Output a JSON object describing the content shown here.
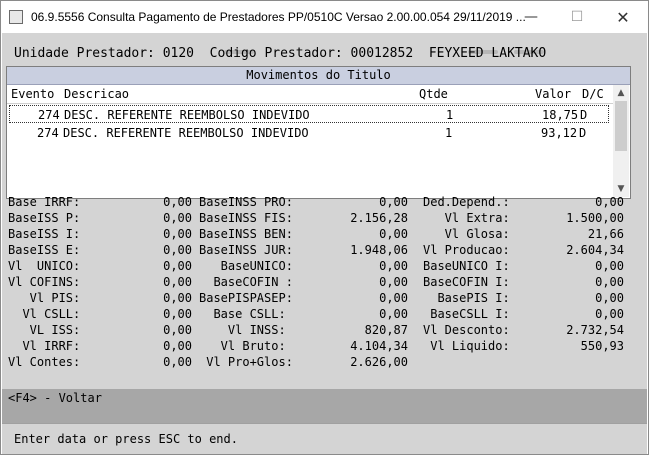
{
  "window": {
    "title": "06.9.5556   Consulta  Pagamento de Prestadores PP/0510C Versao 2.00.00.054 29/11/2019 ...",
    "min_icon": "minimize-icon",
    "max_icon": "maximize-icon",
    "close_icon": "close-icon"
  },
  "info": {
    "text": "Unidade Prestador: 0120  Codigo Prestador: 00012852  FEYXEED LAKTAKO"
  },
  "movimentos": {
    "title": "Movimentos do Titulo",
    "headers": {
      "evento": "Evento",
      "descricao": "Descricao",
      "qtde": "Qtde",
      "valor": "Valor",
      "dc": "D/C"
    },
    "rows": [
      {
        "evento": "274",
        "descricao": "DESC. REFERENTE REEMBOLSO INDEVIDO",
        "qtde": "1",
        "valor": "18,75",
        "dc": "D"
      },
      {
        "evento": "274",
        "descricao": "DESC. REFERENTE REEMBOLSO INDEVIDO",
        "qtde": "1",
        "valor": "93,12",
        "dc": "D"
      }
    ]
  },
  "totals": {
    "col1": [
      {
        "label": "Base IRRF:",
        "value": "0,00"
      },
      {
        "label": "BaseISS P:",
        "value": "0,00"
      },
      {
        "label": "BaseISS I:",
        "value": "0,00"
      },
      {
        "label": "BaseISS E:",
        "value": "0,00"
      },
      {
        "label": "Vl  UNICO:",
        "value": "0,00"
      },
      {
        "label": "Vl COFINS:",
        "value": "0,00"
      },
      {
        "label": "   Vl PIS:",
        "value": "0,00"
      },
      {
        "label": "  Vl CSLL:",
        "value": "0,00"
      },
      {
        "label": "   VL ISS:",
        "value": "0,00"
      },
      {
        "label": "  Vl IRRF:",
        "value": "0,00"
      },
      {
        "label": "Vl Contes:",
        "value": "0,00"
      }
    ],
    "col2": [
      {
        "label": "BaseINSS PRO:",
        "value": "0,00"
      },
      {
        "label": "BaseINSS FIS:",
        "value": "2.156,28"
      },
      {
        "label": "BaseINSS BEN:",
        "value": "0,00"
      },
      {
        "label": "BaseINSS JUR:",
        "value": "1.948,06"
      },
      {
        "label": "   BaseUNICO:",
        "value": "0,00"
      },
      {
        "label": "  BaseCOFIN :",
        "value": "0,00"
      },
      {
        "label": "BasePISPASEP:",
        "value": "0,00"
      },
      {
        "label": "  Base CSLL:",
        "value": "0,00"
      },
      {
        "label": "    Vl INSS:",
        "value": "820,87"
      },
      {
        "label": "   Vl Bruto:",
        "value": "4.104,34"
      },
      {
        "label": " Vl Pro+Glos:",
        "value": "2.626,00"
      }
    ],
    "col3": [
      {
        "label": "Ded.Depend.:",
        "value": "0,00"
      },
      {
        "label": "   Vl Extra:",
        "value": "1.500,00"
      },
      {
        "label": "   Vl Glosa:",
        "value": "21,66"
      },
      {
        "label": "Vl Producao:",
        "value": "2.604,34"
      },
      {
        "label": "BaseUNICO I:",
        "value": "0,00"
      },
      {
        "label": "BaseCOFIN I:",
        "value": "0,00"
      },
      {
        "label": "  BasePIS I:",
        "value": "0,00"
      },
      {
        "label": " BaseCSLL I:",
        "value": "0,00"
      },
      {
        "label": "Vl Desconto:",
        "value": "2.732,54"
      },
      {
        "label": " Vl Liquido:",
        "value": "550,93"
      }
    ]
  },
  "footer": {
    "f4": "<F4> - Voltar",
    "status": "Enter data or press ESC to end."
  },
  "colors": {
    "panel_title_bg": "#c9cfe0",
    "background": "#d4d4d4",
    "f4bar": "#a7a7a7"
  }
}
